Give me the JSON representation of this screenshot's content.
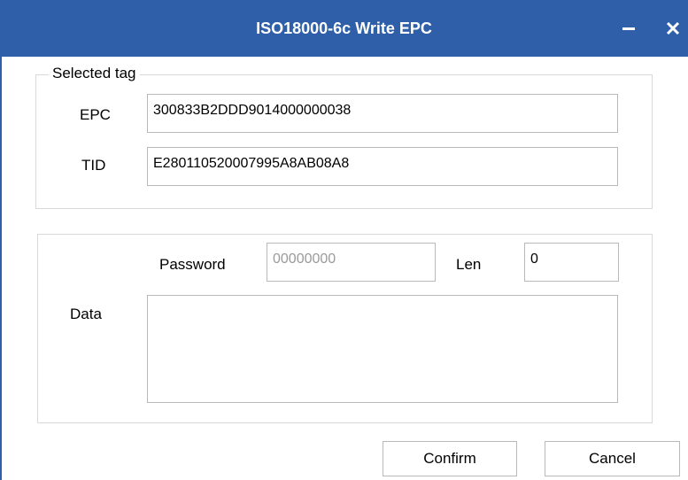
{
  "window": {
    "title": "ISO18000-6c Write EPC",
    "minimize_icon": "minimize-icon",
    "close_icon": "close-icon",
    "accent_color": "#2e5fa8"
  },
  "selected_tag": {
    "legend": "Selected tag",
    "epc_label": "EPC",
    "epc_value": "300833B2DDD9014000000038",
    "tid_label": "TID",
    "tid_value": "E280110520007995A8AB08A8"
  },
  "write": {
    "password_label": "Password",
    "password_placeholder": "00000000",
    "len_label": "Len",
    "len_value": "0",
    "data_label": "Data",
    "data_value": ""
  },
  "buttons": {
    "confirm": "Confirm",
    "cancel": "Cancel"
  }
}
